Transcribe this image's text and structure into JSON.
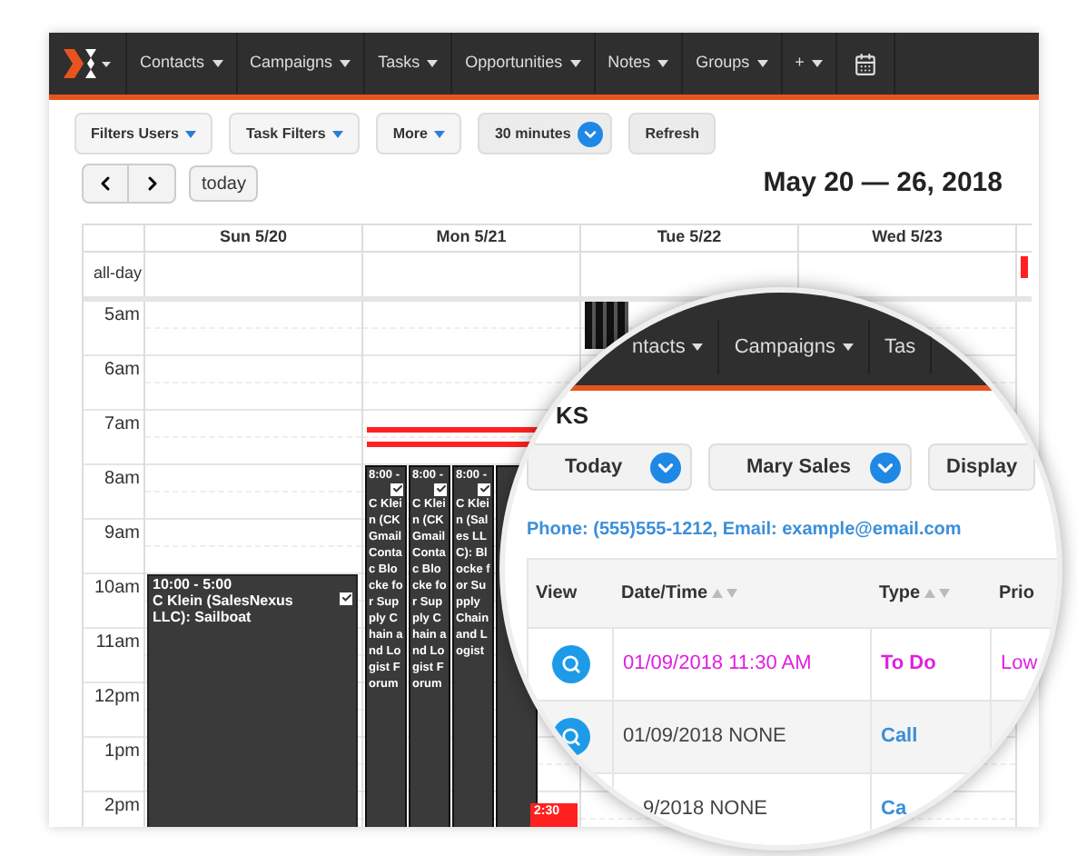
{
  "nav": {
    "items": [
      {
        "label": "Contacts"
      },
      {
        "label": "Campaigns"
      },
      {
        "label": "Tasks"
      },
      {
        "label": "Opportunities"
      },
      {
        "label": "Notes"
      },
      {
        "label": "Groups"
      },
      {
        "label": "+"
      }
    ]
  },
  "toolbar": [
    {
      "label": "Filters Users",
      "kind": "menu"
    },
    {
      "label": "Task Filters",
      "kind": "menu"
    },
    {
      "label": "More",
      "kind": "menu"
    },
    {
      "label": "30 minutes",
      "kind": "select"
    },
    {
      "label": "Refresh",
      "kind": "plain"
    }
  ],
  "today_button": "today",
  "range_title": "May 20 — 26, 2018",
  "calendar": {
    "allday_label": "all-day",
    "hours": [
      "5am",
      "6am",
      "7am",
      "8am",
      "9am",
      "10am",
      "11am",
      "12pm",
      "1pm",
      "2pm"
    ],
    "days": [
      {
        "label": "Sun 5/20",
        "events": [
          {
            "kind": "dark",
            "time": "10:00 - 5:00",
            "title": "C Klein (SalesNexus LLC): Sailboat"
          }
        ]
      },
      {
        "label": "Mon 5/21",
        "events": [
          {
            "kind": "dark",
            "time": "8:00 -",
            "title": "C Klein (CK Gmail Contac Blocke for Supply Chain and Logist Forum"
          },
          {
            "kind": "dark",
            "time": "8:00 -",
            "title": "C Klein (CK Gmail Contac Blocke for Supply Chain and Logist Forum"
          },
          {
            "kind": "dark",
            "time": "8:00 -",
            "title": "C Klein (Sales LLC): Blocke for Supply Chain and Logist"
          },
          {
            "kind": "block"
          },
          {
            "kind": "red",
            "time": "2:30"
          }
        ]
      },
      {
        "label": "Tue 5/22",
        "events": [
          {
            "kind": "stripes"
          }
        ]
      },
      {
        "label": "Wed 5/23"
      }
    ]
  },
  "magnifier": {
    "nav": [
      {
        "label": "ntacts"
      },
      {
        "label": "Campaigns"
      },
      {
        "label": "Tas"
      }
    ],
    "heading": "KS",
    "filters": [
      {
        "label": "Today",
        "kind": "select"
      },
      {
        "label": "Mary Sales",
        "kind": "select"
      },
      {
        "label": "Display",
        "kind": "plain"
      }
    ],
    "contact": "Phone: (555)555-1212, Email: example@email.com",
    "columns": [
      {
        "label": "View",
        "sortable": false
      },
      {
        "label": "Date/Time",
        "sortable": true
      },
      {
        "label": "Type",
        "sortable": true
      },
      {
        "label": "Prio",
        "sortable": false
      }
    ],
    "rows": [
      {
        "kind": "todo",
        "view_icon": true,
        "date": "01/09/2018 11:30 AM",
        "type": "To Do",
        "priority": "Low"
      },
      {
        "kind": "call",
        "view_icon": true,
        "date": "01/09/2018 NONE",
        "type": "Call"
      },
      {
        "kind": "call",
        "view_icon": false,
        "date": "9/2018 NONE",
        "type": "Ca"
      }
    ]
  }
}
